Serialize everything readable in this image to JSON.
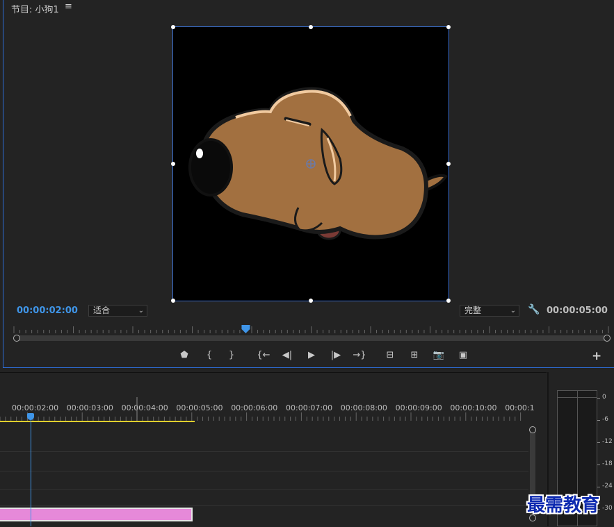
{
  "monitor": {
    "title": "节目: 小狗1",
    "menu_icon": "≡",
    "current_timecode": "00:00:02:00",
    "duration_timecode": "00:00:05:00",
    "fit_label": "适合",
    "quality_label": "完整",
    "playhead_fraction": 0.39
  },
  "transport": {
    "buttons": [
      {
        "name": "add-marker-button",
        "glyph": "⬟"
      },
      {
        "name": "mark-in-button",
        "glyph": "{"
      },
      {
        "name": "mark-out-button",
        "glyph": "}"
      },
      {
        "name": "go-to-in-button",
        "glyph": "{←"
      },
      {
        "name": "step-back-button",
        "glyph": "◀|"
      },
      {
        "name": "play-button",
        "glyph": "▶"
      },
      {
        "name": "step-forward-button",
        "glyph": "|▶"
      },
      {
        "name": "go-to-out-button",
        "glyph": "→}"
      },
      {
        "name": "lift-button",
        "glyph": "⊟"
      },
      {
        "name": "extract-button",
        "glyph": "⊞"
      },
      {
        "name": "export-frame-button",
        "glyph": "📷"
      },
      {
        "name": "compare-view-button",
        "glyph": "▣"
      }
    ],
    "add_label": "+"
  },
  "timeline": {
    "time_labels": [
      "00:00:02:00",
      "00:00:03:00",
      "00:00:04:00",
      "00:00:05:00",
      "00:00:06:00",
      "00:00:07:00",
      "00:00:08:00",
      "00:00:09:00",
      "00:00:10:00",
      "00:00:1"
    ]
  },
  "meter": {
    "db_labels": [
      "0",
      "-6",
      "-12",
      "-18",
      "-24",
      "-30"
    ]
  },
  "watermark": "最需教育",
  "colors": {
    "accent": "#3f95e8",
    "work_area": "#e0cf2d",
    "clip": "#e689d9"
  }
}
